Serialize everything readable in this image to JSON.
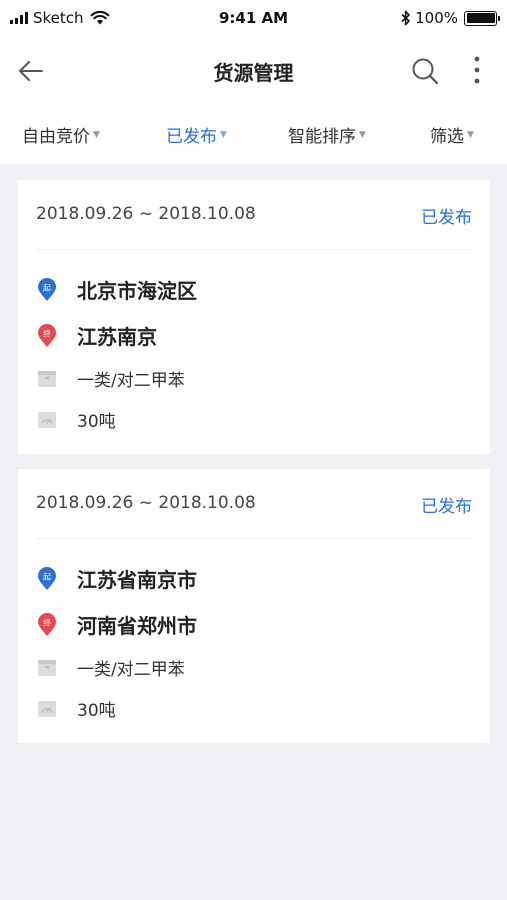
{
  "status_bar": {
    "carrier": "Sketch",
    "time": "9:41 AM",
    "battery": "100%"
  },
  "nav": {
    "title": "货源管理",
    "back_icon": "arrow-left-icon",
    "search_icon": "search-icon",
    "more_icon": "more-vertical-icon"
  },
  "filters": [
    {
      "label": "自由竞价",
      "active": false
    },
    {
      "label": "已发布",
      "active": true
    },
    {
      "label": "智能排序",
      "active": false
    },
    {
      "label": "筛选",
      "active": false
    }
  ],
  "colors": {
    "accent": "#2b6fd6",
    "origin_pin": "#2d6fd6",
    "destination_pin": "#e8474f",
    "background": "#f0f1f5"
  },
  "cards": [
    {
      "date_range": "2018.09.26 ~ 2018.10.08",
      "status": "已发布",
      "origin_badge": "起",
      "origin": "北京市海淀区",
      "destination_badge": "终",
      "destination": "江苏南京",
      "cargo": "一类/对二甲苯",
      "weight": "30吨"
    },
    {
      "date_range": "2018.09.26 ~ 2018.10.08",
      "status": "已发布",
      "origin_badge": "起",
      "origin": "江苏省南京市",
      "destination_badge": "终",
      "destination": "河南省郑州市",
      "cargo": "一类/对二甲苯",
      "weight": "30吨"
    }
  ]
}
